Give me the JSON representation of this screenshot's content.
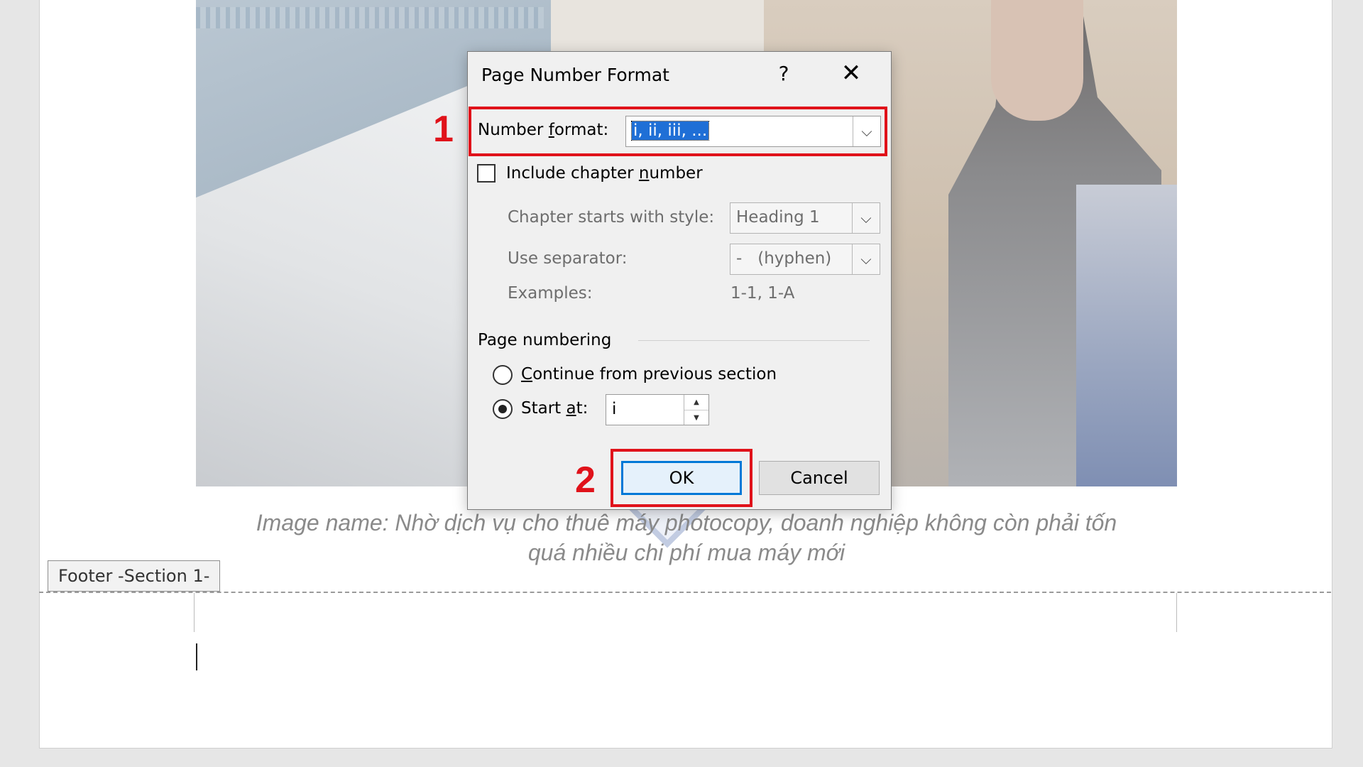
{
  "photo": {
    "alt": "office woman using photocopier"
  },
  "caption": {
    "line1": "Image name: Nhờ dịch vụ cho thuê máy photocopy, doanh nghiệp không còn phải tốn",
    "line2": "quá nhiều chi phí mua máy mới"
  },
  "footer": {
    "tab_label": "Footer -Section 1-"
  },
  "dialog": {
    "title": "Page Number Format",
    "help_label": "?",
    "close_label": "✕",
    "number_format": {
      "label_pre": "Number ",
      "label_key": "f",
      "label_post": "ormat:",
      "value": "i, ii, iii, ..."
    },
    "include_chapter": {
      "label_pre": "Include chapter ",
      "label_key": "n",
      "label_post": "umber",
      "checked": false
    },
    "chapter_style": {
      "label": "Chapter starts with style:",
      "value": "Heading 1"
    },
    "separator": {
      "label": "Use separator:",
      "value": "-   (hyphen)"
    },
    "examples": {
      "label": "Examples:",
      "value": "1-1, 1-A"
    },
    "page_numbering": {
      "heading": "Page numbering",
      "continue": {
        "label_key": "C",
        "label_post": "ontinue from previous section",
        "selected": false
      },
      "start_at": {
        "label_pre": "Start ",
        "label_key": "a",
        "label_post": "t:",
        "selected": true,
        "value": "i"
      }
    },
    "ok_label": "OK",
    "cancel_label": "Cancel"
  },
  "annotations": {
    "step1": "1",
    "step2": "2",
    "highlight_color": "#e0121a"
  },
  "colors": {
    "selection": "#1f6fd6",
    "primary_border": "#0078d7"
  }
}
